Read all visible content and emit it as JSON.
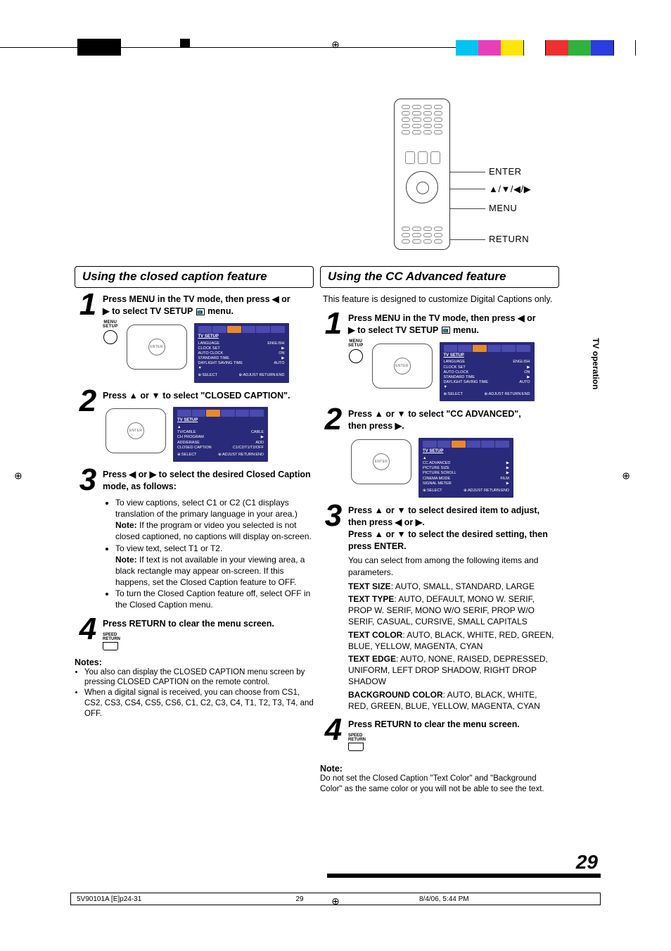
{
  "page_number": "29",
  "side_tab": "TV operation",
  "registration_marks": "⊕",
  "remote_labels": {
    "enter": "ENTER",
    "arrows": "▲/▼/◀/▶",
    "menu": "MENU",
    "return": "RETURN"
  },
  "left": {
    "title": "Using the closed caption feature",
    "step1": {
      "num": "1",
      "text_a": "Press MENU in the TV mode, then press ◀ or",
      "text_b": "▶ to select TV SETUP ",
      "text_c": " menu.",
      "menu_btn_label": "MENU\nSETUP",
      "osd": {
        "header": "TV SETUP",
        "rows": [
          [
            "LANGUAGE",
            "ENGLISH"
          ],
          [
            "CLOCK SET",
            "▶"
          ],
          [
            "AUTO CLOCK",
            "ON"
          ],
          [
            "STANDARD TIME",
            "▶"
          ],
          [
            "DAYLIGHT SAVING TIME",
            "AUTO"
          ],
          [
            "▼",
            ""
          ]
        ],
        "foot_l": "⊕:SELECT",
        "foot_r": "⊕:ADJUST  RETURN:END"
      }
    },
    "step2": {
      "num": "2",
      "text": "Press ▲ or ▼ to select \"CLOSED CAPTION\".",
      "osd": {
        "header": "TV SETUP",
        "rows": [
          [
            "▲",
            ""
          ],
          [
            "TV/CABLE",
            "CABLE"
          ],
          [
            "CH PROGRAM",
            "▶"
          ],
          [
            "ADD/ERASE",
            "ADD"
          ],
          [
            "CLOSED CAPTION",
            "C1/C2/T1/T2/OFF"
          ]
        ],
        "foot_l": "⊕:SELECT",
        "foot_r": "⊕:ADJUST  RETURN:END"
      }
    },
    "step3": {
      "num": "3",
      "heading": "Press ◀ or ▶ to select the desired Closed Caption mode, as follows:",
      "b1a": "To view captions, select C1 or C2 (C1 displays translation of the primary language in your area.)",
      "b1b_label": "Note:",
      "b1b": " If the program or video you selected is not closed captioned, no captions will display on-screen.",
      "b2a": "To view text, select T1 or T2.",
      "b2b_label": "Note:",
      "b2b": " If text is not available in your viewing area, a black rectangle may appear on-screen. If this happens, set the Closed Caption feature to OFF.",
      "b3": "To turn the Closed Caption feature off, select OFF in the Closed Caption menu."
    },
    "step4": {
      "num": "4",
      "text": "Press RETURN to clear the menu screen.",
      "btn_label": "SPEED\nRETURN"
    },
    "notes_h": "Notes:",
    "note1": "You also can display the CLOSED CAPTION menu screen by pressing CLOSED CAPTION on the remote control.",
    "note2": "When a digital signal is received, you can choose from CS1, CS2, CS3, CS4, CS5, CS6, C1, C2, C3, C4, T1, T2, T3, T4, and OFF."
  },
  "right": {
    "title": "Using the CC Advanced feature",
    "intro": "This feature is designed to customize Digital Captions only.",
    "step1": {
      "num": "1",
      "text_a": "Press MENU in the TV mode, then press ◀ or",
      "text_b": "▶ to select TV SETUP ",
      "text_c": " menu.",
      "menu_btn_label": "MENU\nSETUP",
      "osd": {
        "header": "TV SETUP",
        "rows": [
          [
            "LANGUAGE",
            "ENGLISH"
          ],
          [
            "CLOCK SET",
            "▶"
          ],
          [
            "AUTO CLOCK",
            "ON"
          ],
          [
            "STANDARD TIME",
            "▶"
          ],
          [
            "DAYLIGHT SAVING TIME",
            "AUTO"
          ],
          [
            "▼",
            ""
          ]
        ],
        "foot_l": "⊕:SELECT",
        "foot_r": "⊕:ADJUST  RETURN:END"
      }
    },
    "step2": {
      "num": "2",
      "text_a": "Press ▲ or ▼ to select \"CC ADVANCED\",",
      "text_b": "then press ▶.",
      "osd": {
        "header": "TV SETUP",
        "rows": [
          [
            "▲",
            ""
          ],
          [
            "CC ADVANCED",
            "▶"
          ],
          [
            "PICTURE SIZE",
            "▶"
          ],
          [
            "PICTURE SCROLL",
            "▶"
          ],
          [
            "CINEMA MODE",
            "FILM"
          ],
          [
            "SIGNAL METER",
            "▶"
          ]
        ],
        "foot_l": "⊕:SELECT",
        "foot_r": "⊕:ADJUST  RETURN:END"
      }
    },
    "step3": {
      "num": "3",
      "l1": "Press ▲ or ▼ to select desired item to adjust, then press ◀ or ▶.",
      "l2": "Press ▲ or ▼ to select the desired setting, then press ENTER.",
      "body": "You can select from among the following items and parameters.",
      "params": [
        {
          "k": "TEXT SIZE",
          "v": ": AUTO, SMALL, STANDARD, LARGE"
        },
        {
          "k": "TEXT TYPE",
          "v": ": AUTO, DEFAULT, MONO W. SERIF, PROP W. SERIF, MONO W/O SERIF, PROP W/O SERIF, CASUAL, CURSIVE, SMALL CAPITALS"
        },
        {
          "k": "TEXT COLOR",
          "v": ": AUTO, BLACK, WHITE, RED, GREEN, BLUE, YELLOW, MAGENTA, CYAN"
        },
        {
          "k": "TEXT EDGE",
          "v": ": AUTO, NONE, RAISED, DEPRESSED, UNIFORM, LEFT DROP SHADOW, RIGHT DROP SHADOW"
        },
        {
          "k": "BACKGROUND COLOR",
          "v": ": AUTO, BLACK, WHITE, RED, GREEN, BLUE, YELLOW, MAGENTA, CYAN"
        }
      ]
    },
    "step4": {
      "num": "4",
      "text": "Press RETURN to clear the menu screen.",
      "btn_label": "SPEED\nRETURN"
    },
    "note_h": "Note:",
    "note": "Do not set the Closed Caption \"Text Color\" and \"Background Color\" as the same color or you will not be able to see the text."
  },
  "footer": {
    "a": "5V90101A [E]p24-31",
    "b": "29",
    "c": "8/4/06, 5:44 PM"
  }
}
